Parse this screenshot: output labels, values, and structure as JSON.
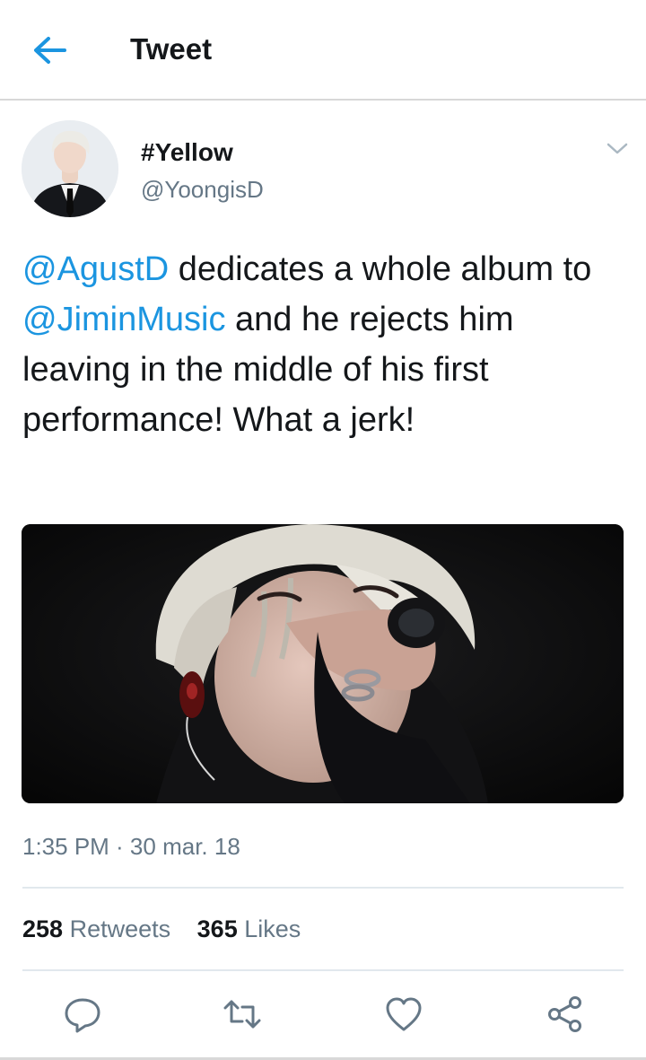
{
  "header": {
    "title": "Tweet",
    "back_icon": "arrow-left-icon"
  },
  "colors": {
    "accent": "#1b95e0",
    "text": "#14171a",
    "muted": "#657786",
    "divider": "#e1e8ed"
  },
  "tweet": {
    "display_name": "#Yellow",
    "handle": "@YoongisD",
    "text_parts": [
      {
        "text": "@AgustD",
        "mention": true
      },
      {
        "text": " dedicates a whole album to ",
        "mention": false
      },
      {
        "text": "@JiminMusic",
        "mention": true
      },
      {
        "text": " and he rejects him leaving in the middle of his first performance! What a jerk!",
        "mention": false
      }
    ],
    "timestamp": "1:35 PM · 30 mar. 18",
    "retweets_count": "258",
    "retweets_label": "Retweets",
    "likes_count": "365",
    "likes_label": "Likes"
  },
  "actions": [
    {
      "name": "reply-button",
      "icon": "reply-icon"
    },
    {
      "name": "retweet-button",
      "icon": "retweet-icon"
    },
    {
      "name": "like-button",
      "icon": "heart-icon"
    },
    {
      "name": "share-button",
      "icon": "share-icon"
    }
  ]
}
